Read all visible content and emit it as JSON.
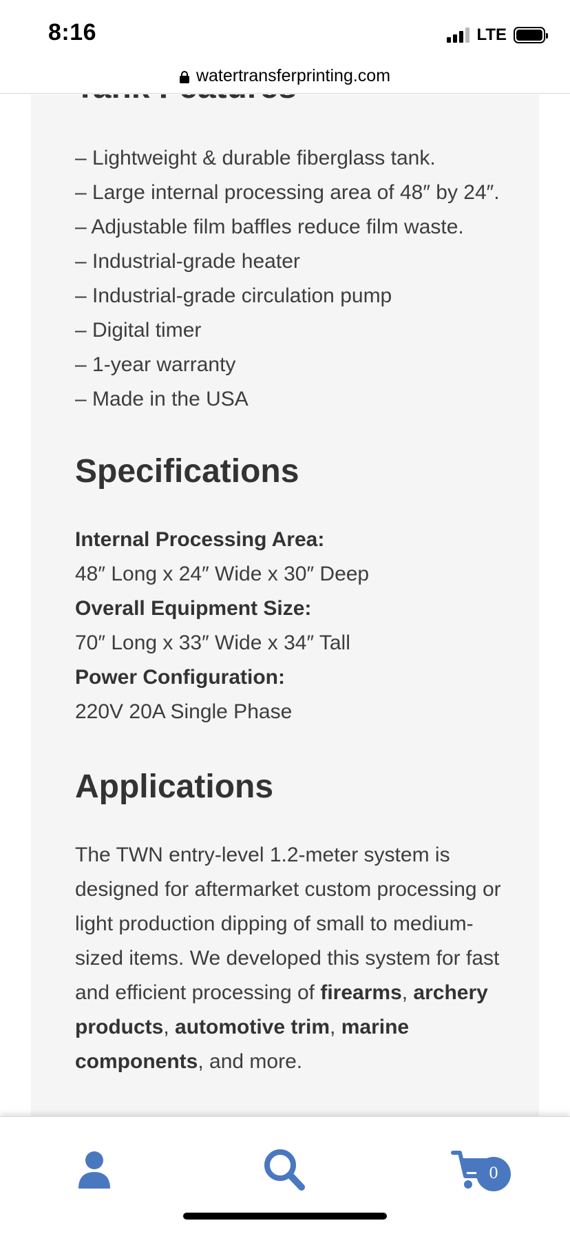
{
  "status_bar": {
    "time": "8:16",
    "network": "LTE",
    "icons": [
      "signal-icon",
      "battery-icon"
    ]
  },
  "browser": {
    "url": "watertransferprinting.com",
    "icons": [
      "lock-icon"
    ]
  },
  "content": {
    "cut_heading": "Tank Features",
    "features": [
      "– Lightweight & durable fiberglass tank.",
      "– Large internal processing area of 48″ by 24″.",
      "– Adjustable film baffles reduce film waste.",
      "– Industrial-grade heater",
      "– Industrial-grade circulation pump",
      "– Digital timer",
      "– 1-year warranty",
      "– Made in the USA"
    ],
    "specifications": {
      "heading": "Specifications",
      "items": [
        {
          "label": "Internal Processing Area:",
          "value": "48″ Long x 24″ Wide x 30″ Deep"
        },
        {
          "label": "Overall Equipment Size:",
          "value": "70″ Long x 33″ Wide x 34″ Tall"
        },
        {
          "label": "Power Configuration:",
          "value": "220V 20A Single Phase"
        }
      ]
    },
    "applications": {
      "heading": "Applications",
      "text_intro": "The TWN entry-level 1.2-meter system is designed for aftermarket custom processing or light production dipping of small to medium-sized items. We developed this system for fast and efficient processing of ",
      "bold_1": "firearms",
      "sep_1": ", ",
      "bold_2": "archery products",
      "sep_2": ", ",
      "bold_3": "automotive trim",
      "sep_3": ", ",
      "bold_4": "marine components",
      "text_end": ", and more."
    }
  },
  "bottom_nav": {
    "accent_color": "#4a78c0",
    "items": [
      {
        "icon": "account-icon"
      },
      {
        "icon": "search-icon"
      },
      {
        "icon": "cart-icon"
      }
    ],
    "cart_count": "0"
  }
}
